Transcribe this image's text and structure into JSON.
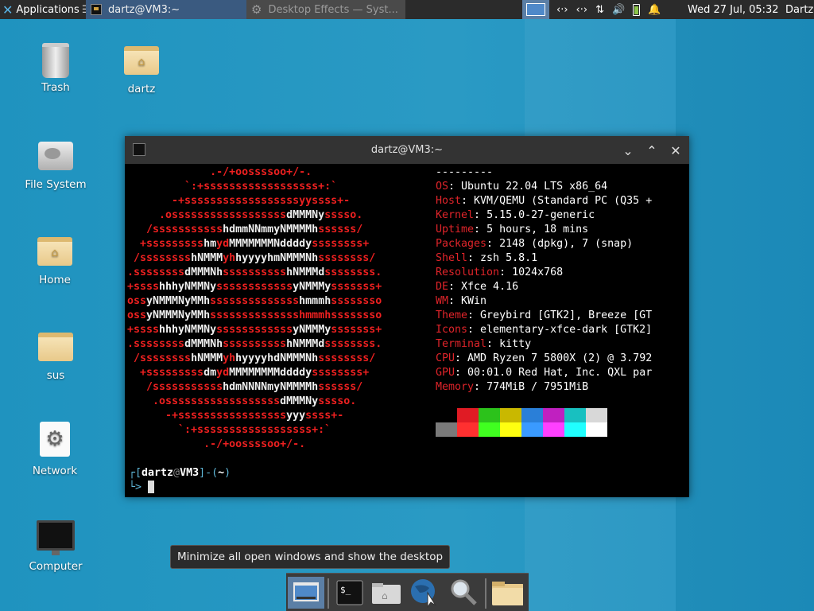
{
  "top_panel": {
    "applications_label": "Applications",
    "task1": "dartz@VM3:~",
    "task2": "Desktop Effects  — Syst...",
    "clock": "Wed 27 Jul, 05:32",
    "user": "Dartz",
    "tray": [
      "network-icon",
      "network-icon",
      "transfer-icon",
      "volume-icon",
      "battery-icon",
      "bell-icon"
    ]
  },
  "desktop": {
    "icons": [
      {
        "label": "Trash",
        "icon": "trash-icon"
      },
      {
        "label": "dartz",
        "icon": "home-folder-icon"
      },
      {
        "label": "File System",
        "icon": "drive-icon"
      },
      {
        "label": "Home",
        "icon": "home-folder-icon"
      },
      {
        "label": "sus",
        "icon": "folder-icon"
      },
      {
        "label": "Network",
        "icon": "network-settings-icon"
      },
      {
        "label": "Computer",
        "icon": "monitor-icon"
      }
    ]
  },
  "terminal": {
    "title": "dartz@VM3:~",
    "separator": "---------",
    "info": [
      {
        "key": "OS",
        "value": "Ubuntu 22.04 LTS x86_64"
      },
      {
        "key": "Host",
        "value": "KVM/QEMU (Standard PC (Q35 +"
      },
      {
        "key": "Kernel",
        "value": "5.15.0-27-generic"
      },
      {
        "key": "Uptime",
        "value": "5 hours, 18 mins"
      },
      {
        "key": "Packages",
        "value": "2148 (dpkg), 7 (snap)"
      },
      {
        "key": "Shell",
        "value": "zsh 5.8.1"
      },
      {
        "key": "Resolution",
        "value": "1024x768"
      },
      {
        "key": "DE",
        "value": "Xfce 4.16"
      },
      {
        "key": "WM",
        "value": "KWin"
      },
      {
        "key": "Theme",
        "value": "Greybird [GTK2], Breeze [GT"
      },
      {
        "key": "Icons",
        "value": "elementary-xfce-dark [GTK2]"
      },
      {
        "key": "Terminal",
        "value": "kitty"
      },
      {
        "key": "CPU",
        "value": "AMD Ryzen 7 5800X (2) @ 3.792"
      },
      {
        "key": "GPU",
        "value": "00:01.0 Red Hat, Inc. QXL par"
      },
      {
        "key": "Memory",
        "value": "774MiB / 7951MiB"
      }
    ],
    "palette_dark": [
      "#000000",
      "#e01b24",
      "#2cc21b",
      "#c9b800",
      "#2a7fd8",
      "#c020c0",
      "#18c0c0",
      "#d8d8d8"
    ],
    "palette_bright": [
      "#7a7a7a",
      "#ff3030",
      "#40ff20",
      "#ffff10",
      "#3a9aff",
      "#ff40ff",
      "#20ffff",
      "#ffffff"
    ],
    "prompt": {
      "user": "dartz",
      "at": "@",
      "host": "VM3",
      "dir": "~"
    }
  },
  "tooltip": "Minimize all open windows and show the desktop",
  "dock": [
    "show-desktop-icon",
    "terminal-icon",
    "home-folder-icon",
    "web-browser-icon",
    "search-icon",
    "folder-icon"
  ]
}
